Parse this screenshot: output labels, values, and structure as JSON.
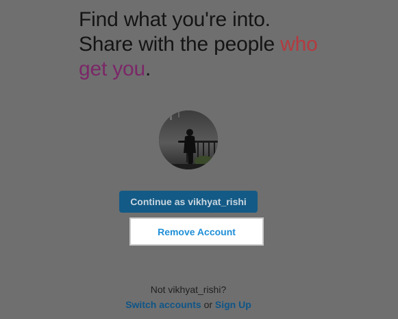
{
  "headline": {
    "line1": "Find what you're into.",
    "line2_plain": "Share with the people ",
    "line2_accent": "who",
    "line3_accent": "get you",
    "line3_end": "."
  },
  "profile": {
    "avatar_icon": "user-photo"
  },
  "buttons": {
    "continue_label": "Continue as vikhyat_rishi",
    "remove_label": "Remove Account"
  },
  "footer": {
    "not_user_text": "Not vikhyat_rishi?",
    "switch_accounts_label": "Switch accounts",
    "or_text": "or",
    "sign_up_label": "Sign Up"
  },
  "colors": {
    "background": "#6f6f6f",
    "continue_button": "#135a86",
    "link_blue": "#1e8fd6",
    "accent_red": "#b43a3f",
    "accent_purple": "#7b2768"
  }
}
